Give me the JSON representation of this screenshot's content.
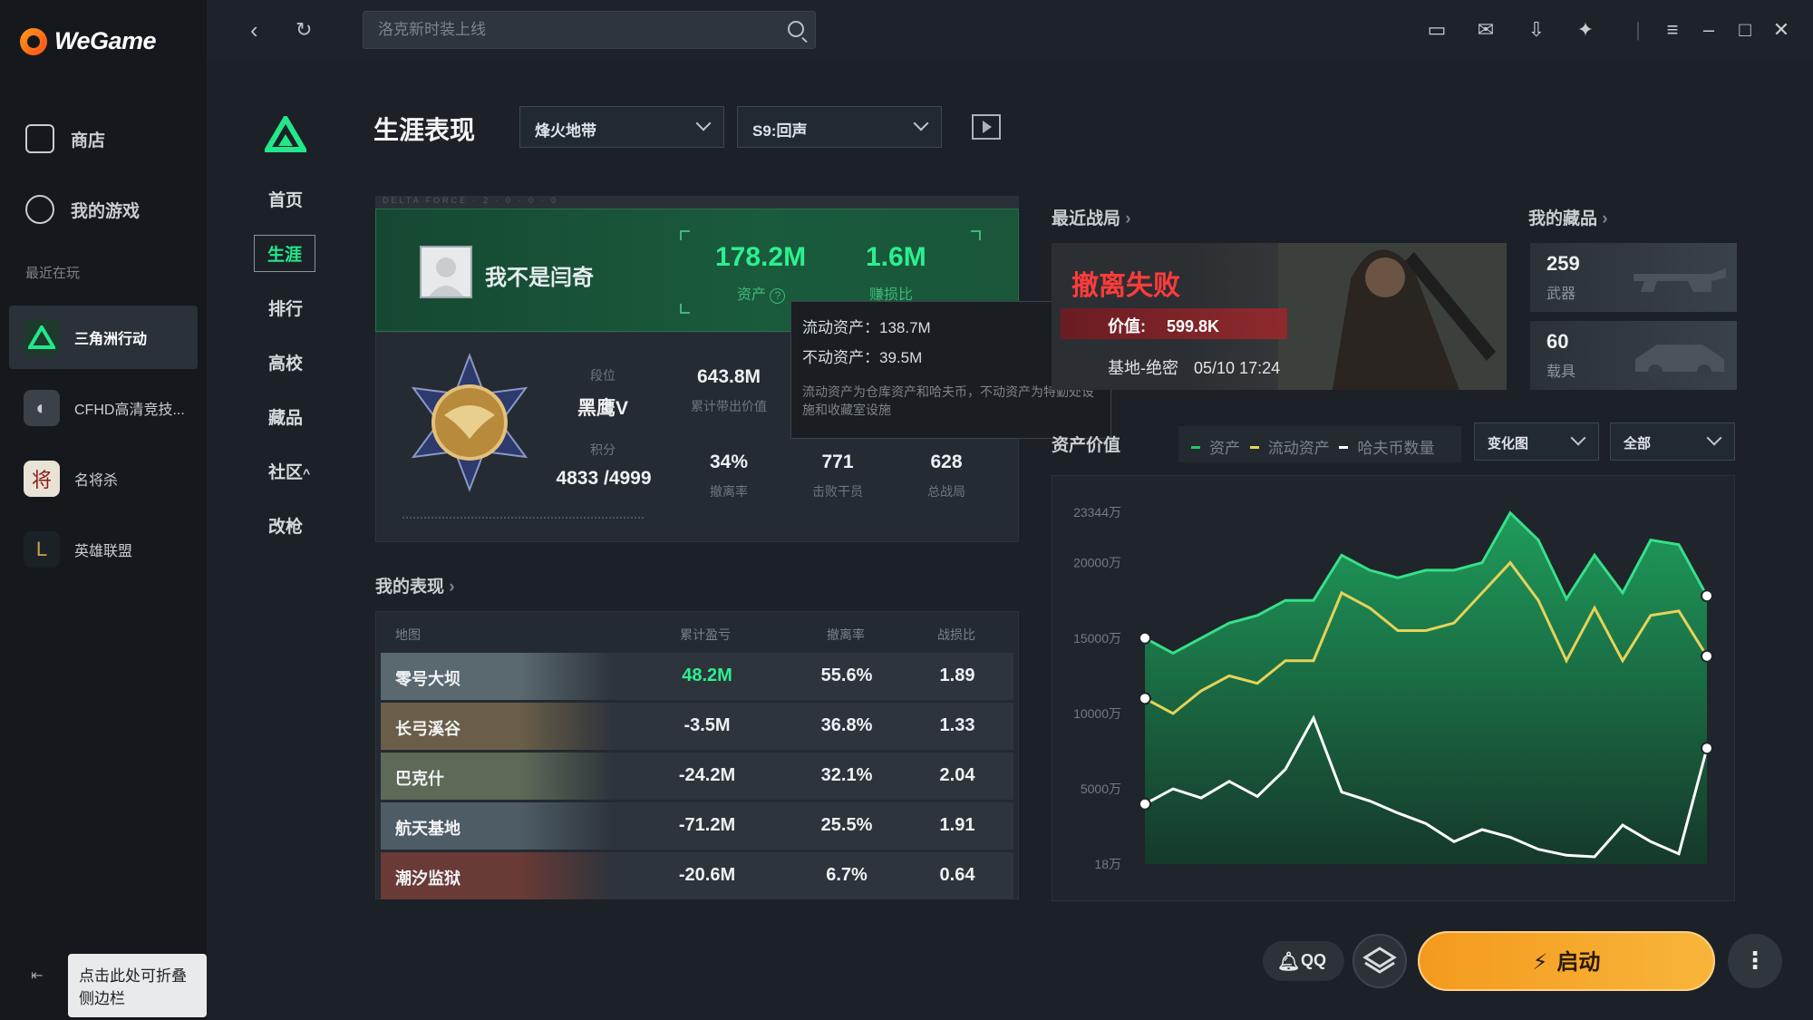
{
  "app": {
    "name": "WeGame"
  },
  "sidebar": {
    "nav": [
      {
        "label": "商店",
        "icon": "shop-icon"
      },
      {
        "label": "我的游戏",
        "icon": "controller-icon"
      }
    ],
    "recent_label": "最近在玩",
    "games": [
      {
        "label": "三角洲行动",
        "active": true
      },
      {
        "label": "CFHD高清竞技...",
        "active": false
      },
      {
        "label": "名将杀",
        "active": false
      },
      {
        "label": "英雄联盟",
        "active": false
      }
    ],
    "collapse_tip": "点击此处可折叠侧边栏"
  },
  "topbar": {
    "search_placeholder": "洛克新时装上线"
  },
  "game_nav": {
    "items": [
      "首页",
      "生涯",
      "排行",
      "高校",
      "藏品",
      "社区",
      "改枪"
    ],
    "community_caret": "^"
  },
  "page": {
    "title": "生涯表现",
    "mode_select": "烽火地带",
    "season_select": "S9:回声"
  },
  "profile": {
    "strip_text": "DELTA FORCE · 2 · 0 · 0 · 0",
    "nickname": "我不是闫奇",
    "assets": "178.2M",
    "assets_label": "资产",
    "kd": "1.6M",
    "kd_label": "赚损比",
    "rank_label": "段位",
    "rank": "黑鹰V",
    "score_label": "积分",
    "score": "4833 /4999",
    "total_value": "643.8M",
    "total_value_label": "累计带出价值",
    "extract_rate": "34%",
    "extract_rate_label": "撤离率",
    "kills": "771",
    "kills_label": "击败干员",
    "total_battles": "628",
    "total_battles_label": "总战局"
  },
  "tooltip": {
    "liquid": "流动资产：138.7M",
    "fixed": "不动资产：39.5M",
    "note": "流动资产为仓库资产和哈夫币，不动资产为特勤处设施和收藏室设施"
  },
  "performance": {
    "title": "我的表现",
    "headers": [
      "地图",
      "累计盈亏",
      "撤离率",
      "战损比"
    ],
    "rows": [
      {
        "map": "零号大坝",
        "profit": "48.2M",
        "rate": "55.6%",
        "kd": "1.89",
        "positive": true
      },
      {
        "map": "长弓溪谷",
        "profit": "-3.5M",
        "rate": "36.8%",
        "kd": "1.33",
        "positive": false
      },
      {
        "map": "巴克什",
        "profit": "-24.2M",
        "rate": "32.1%",
        "kd": "2.04",
        "positive": false
      },
      {
        "map": "航天基地",
        "profit": "-71.2M",
        "rate": "25.5%",
        "kd": "1.91",
        "positive": false
      },
      {
        "map": "潮汐监狱",
        "profit": "-20.6M",
        "rate": "6.7%",
        "kd": "0.64",
        "positive": false
      }
    ]
  },
  "recent_battle": {
    "title": "最近战局",
    "result": "撤离失败",
    "value_label": "价值:",
    "value": "599.8K",
    "map": "基地-绝密",
    "time": "05/10 17:24"
  },
  "collection": {
    "title": "我的藏品",
    "items": [
      {
        "count": "259",
        "label": "武器"
      },
      {
        "count": "60",
        "label": "载具"
      }
    ]
  },
  "asset_chart": {
    "title": "资产价值",
    "chart_select": "变化图",
    "filter_select": "全部",
    "legend": [
      {
        "name": "资产",
        "color": "#22c76b"
      },
      {
        "name": "流动资产",
        "color": "#e6d25a"
      },
      {
        "name": "哈夫币数量",
        "color": "#ffffff"
      }
    ]
  },
  "chart_data": {
    "type": "area",
    "title": "资产价值",
    "y_ticks": [
      "23344万",
      "20000万",
      "15000万",
      "10000万",
      "5000万",
      "18万"
    ],
    "y_tick_values": [
      23344,
      20000,
      15000,
      10000,
      5000,
      18
    ],
    "ylim": [
      18,
      23344
    ],
    "series": [
      {
        "name": "资产",
        "values": [
          15000,
          14000,
          15000,
          16000,
          16500,
          17500,
          17500,
          20500,
          19500,
          19000,
          19500,
          19500,
          20000,
          23300,
          21500,
          17600,
          20500,
          18000,
          21500,
          21200,
          17800
        ]
      },
      {
        "name": "流动资产",
        "values": [
          11000,
          10000,
          11500,
          12500,
          12000,
          13500,
          13500,
          18000,
          17000,
          15500,
          15500,
          16000,
          18000,
          20000,
          17500,
          13500,
          17000,
          13500,
          16500,
          16800,
          13800
        ]
      },
      {
        "name": "哈夫币数量",
        "values": [
          4000,
          5000,
          4400,
          5500,
          4500,
          6300,
          9700,
          4800,
          4200,
          3400,
          2700,
          1500,
          2300,
          1800,
          1000,
          600,
          500,
          2600,
          1500,
          700,
          7700
        ]
      }
    ]
  },
  "bottom": {
    "qq_label": "QQ",
    "start_label": "启动",
    "more_label": "⋮"
  }
}
